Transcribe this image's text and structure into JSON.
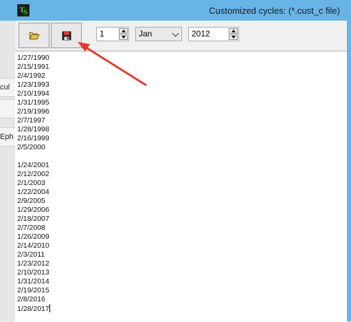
{
  "window": {
    "title": "Customized cycles: (*.cust_c file)",
    "icon": "ts-app-icon"
  },
  "background_window": {
    "fragments": [
      "cul",
      "",
      "Eph"
    ]
  },
  "toolbar": {
    "open_button_icon": "folder-open-icon",
    "save_button_icon": "floppy-disk-icon",
    "day_value": "1",
    "month_value": "Jan",
    "year_value": "2012"
  },
  "editor": {
    "lines": [
      "1/27/1990",
      "2/15/1991",
      "2/4/1992",
      "1/23/1993",
      "2/10/1994",
      "1/31/1995",
      "2/19/1996",
      "2/7/1997",
      "1/28/1998",
      "2/16/1999",
      "2/5/2000",
      "",
      "1/24/2001",
      "2/12/2002",
      "2/1/2003",
      "1/22/2004",
      "2/9/2005",
      "1/29/2006",
      "2/18/2007",
      "2/7/2008",
      "1/26/2009",
      "2/14/2010",
      "2/3/2011",
      "1/23/2012",
      "2/10/2013",
      "1/31/2014",
      "2/19/2015",
      "2/8/2016",
      "1/28/2017"
    ]
  },
  "annotation": {
    "color": "#e53a2f"
  }
}
